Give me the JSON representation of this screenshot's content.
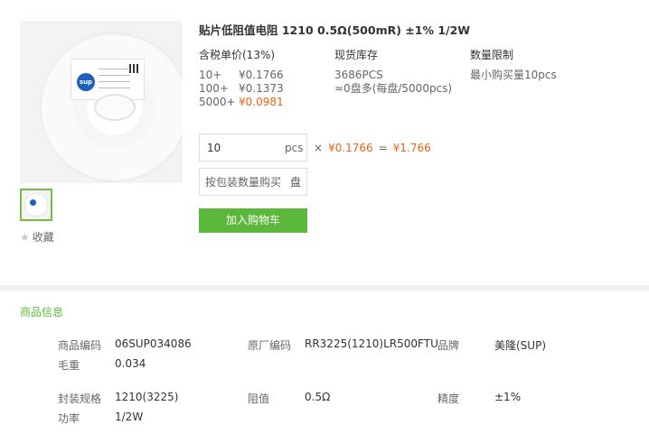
{
  "product": {
    "title": "贴片低阻值电阻 1210 0.5Ω(500mR) ±1% 1/2W",
    "image_alt": "SUP resistor reel",
    "favorite_label": "收藏"
  },
  "pricing": {
    "header": "含税单价(13%)",
    "tiers": [
      {
        "qty": "10+",
        "price": "¥0.1766",
        "highlight": false
      },
      {
        "qty": "100+",
        "price": "¥0.1373",
        "highlight": false
      },
      {
        "qty": "5000+",
        "price": "¥0.0981",
        "highlight": true
      }
    ]
  },
  "stock": {
    "header": "现货库存",
    "count": "3686PCS",
    "note": "≈0盘多(每盘/5000pcs)"
  },
  "limit": {
    "header": "数量限制",
    "text": "最小购买量10pcs"
  },
  "order": {
    "quantity": "10",
    "unit": "pcs",
    "times": "×",
    "unit_price": "¥0.1766",
    "equals": "=",
    "total": "¥1.766",
    "reel_placeholder": "按包装数量购买",
    "reel_unit": "盘",
    "cart_label": "加入购物车"
  },
  "info": {
    "section_title": "商品信息",
    "rows": [
      {
        "label": "商品编码",
        "value": "06SUP034086"
      },
      {
        "label": "原厂编码",
        "value": "RR3225(1210)LR500FTU"
      },
      {
        "label": "品牌",
        "value": "美隆(SUP)"
      },
      {
        "label": "毛重",
        "value": "0.034"
      },
      {
        "label": "封装规格",
        "value": "1210(3225)"
      },
      {
        "label": "阻值",
        "value": "0.5Ω"
      },
      {
        "label": "精度",
        "value": "±1%"
      },
      {
        "label": "功率",
        "value": "1/2W"
      }
    ]
  },
  "colors": {
    "accent_green": "#5cb83a",
    "price_orange": "#e96516"
  },
  "icons": {
    "favorite": "star-icon"
  }
}
